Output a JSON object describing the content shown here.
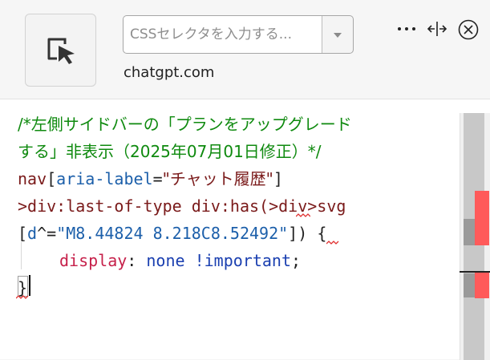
{
  "toolbar": {
    "selector_placeholder": "CSSセレクタを入力する...",
    "domain": "chatgpt.com",
    "icons": {
      "picker": "element-picker-icon",
      "more": "more-icon",
      "resize": "resize-horizontal-icon",
      "close": "close-circle-icon"
    }
  },
  "editor": {
    "line1": "/*左側サイドバーの「プランをアップグレード",
    "line2": "する」非表示（2025年07月01日修正）*/",
    "line3": {
      "tag": "nav",
      "lb": "[",
      "attr": "aria-label",
      "eq": "=",
      "value": "\"チャット履歴\"",
      "rb": "]"
    },
    "line4": {
      "a": ">div:last-of-type div:has(",
      "b": ">div>svg"
    },
    "line5": {
      "lb": "[",
      "attr": "d",
      "op": "^=",
      "value": "\"M8.44824 8.218C8.52492\"",
      "rb": "]",
      "close": ")",
      "brace": "{"
    },
    "line6": {
      "prop": "display",
      "colon": ":",
      "value": "none !important",
      "semi": ";"
    },
    "line7": "}"
  },
  "colors": {
    "comment": "#0f8a0f",
    "error_mark": "#ff5a5a",
    "scroll_thumb": "#c8c8c8"
  }
}
